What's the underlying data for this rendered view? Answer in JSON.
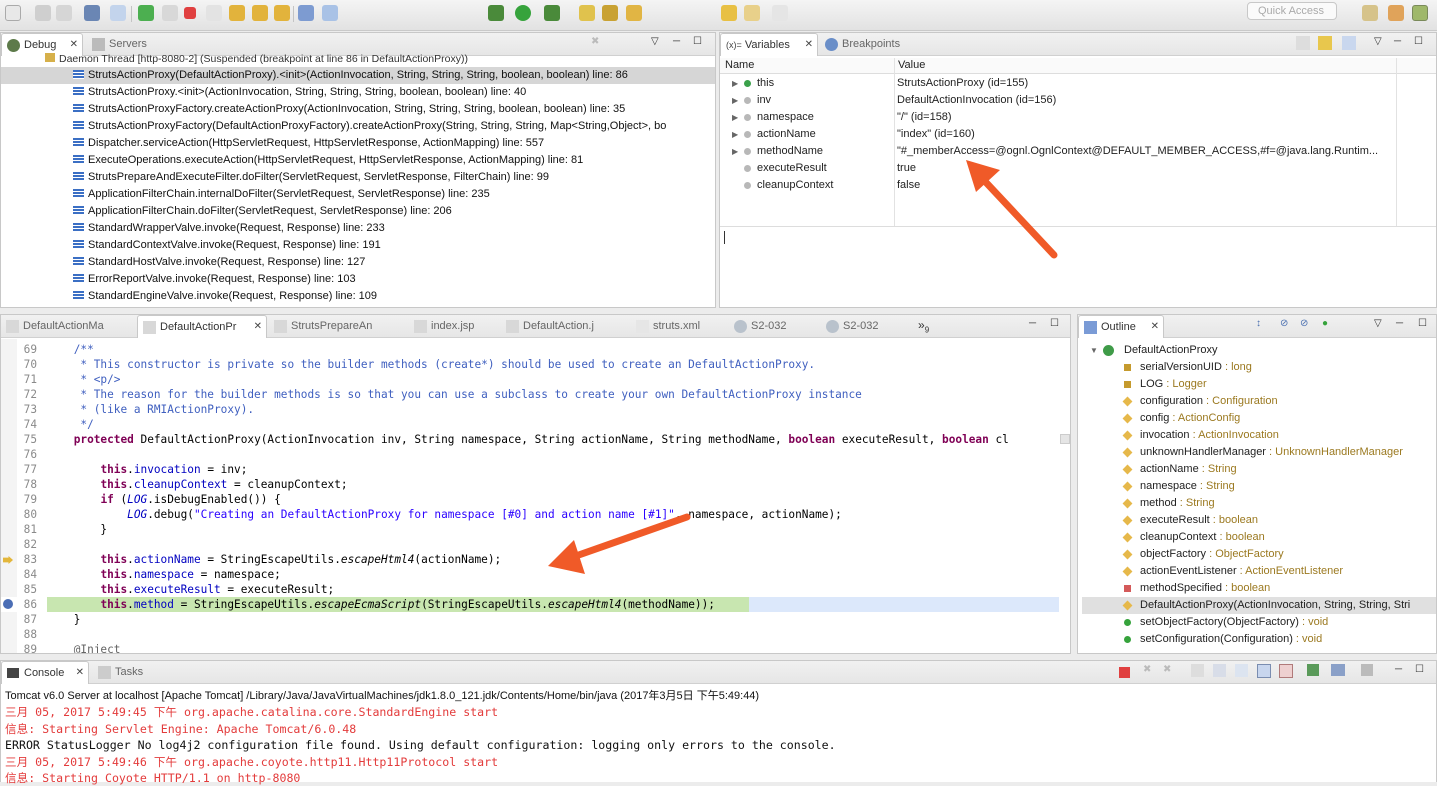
{
  "colors": {
    "accent_orange": "#f05a28",
    "highlight_green": "#c8e6b0",
    "exec_line": "#dce8fb",
    "console_red": "#e33b3b"
  },
  "toolbar": {
    "quick_access_placeholder": "Quick Access"
  },
  "debug_view": {
    "tabs": [
      {
        "label": "Debug",
        "icon": "debug-bug-icon"
      },
      {
        "label": "Servers",
        "icon": "servers-icon"
      }
    ],
    "thread_label": "Daemon Thread [http-8080-2] (Suspended (breakpoint at line 86 in DefaultActionProxy))",
    "frames": [
      "StrutsActionProxy(DefaultActionProxy).<init>(ActionInvocation, String, String, String, boolean, boolean) line: 86",
      "StrutsActionProxy.<init>(ActionInvocation, String, String, String, boolean, boolean) line: 40",
      "StrutsActionProxyFactory.createActionProxy(ActionInvocation, String, String, String, boolean, boolean) line: 35",
      "StrutsActionProxyFactory(DefaultActionProxyFactory).createActionProxy(String, String, String, Map<String,Object>, bo",
      "Dispatcher.serviceAction(HttpServletRequest, HttpServletResponse, ActionMapping) line: 557",
      "ExecuteOperations.executeAction(HttpServletRequest, HttpServletResponse, ActionMapping) line: 81",
      "StrutsPrepareAndExecuteFilter.doFilter(ServletRequest, ServletResponse, FilterChain) line: 99",
      "ApplicationFilterChain.internalDoFilter(ServletRequest, ServletResponse) line: 235",
      "ApplicationFilterChain.doFilter(ServletRequest, ServletResponse) line: 206",
      "StandardWrapperValve.invoke(Request, Response) line: 233",
      "StandardContextValve.invoke(Request, Response) line: 191",
      "StandardHostValve.invoke(Request, Response) line: 127",
      "ErrorReportValve.invoke(Request, Response) line: 103",
      "StandardEngineValve.invoke(Request, Response) line: 109"
    ]
  },
  "variables_view": {
    "tabs": [
      {
        "label": "Variables",
        "prefix": "(x)="
      },
      {
        "label": "Breakpoints"
      }
    ],
    "col_name": "Name",
    "col_value": "Value",
    "rows": [
      {
        "name": "this",
        "value": "StrutsActionProxy  (id=155)",
        "expandable": true,
        "icon": "green"
      },
      {
        "name": "inv",
        "value": "DefaultActionInvocation  (id=156)",
        "expandable": true,
        "icon": "grey"
      },
      {
        "name": "namespace",
        "value": "\"/\" (id=158)",
        "expandable": true,
        "icon": "grey"
      },
      {
        "name": "actionName",
        "value": "\"index\" (id=160)",
        "expandable": true,
        "icon": "grey"
      },
      {
        "name": "methodName",
        "value": "\"#_memberAccess=@ognl.OgnlContext@DEFAULT_MEMBER_ACCESS,#f=@java.lang.Runtim...",
        "expandable": true,
        "icon": "grey"
      },
      {
        "name": "executeResult",
        "value": "true",
        "expandable": false,
        "icon": "grey"
      },
      {
        "name": "cleanupContext",
        "value": "false",
        "expandable": false,
        "icon": "grey"
      }
    ]
  },
  "editor": {
    "tabs": [
      {
        "label": "DefaultActionMa",
        "active": false
      },
      {
        "label": "DefaultActionPr",
        "active": true
      },
      {
        "label": "StrutsPrepareAn",
        "active": false
      },
      {
        "label": "index.jsp",
        "active": false
      },
      {
        "label": "DefaultAction.j",
        "active": false
      },
      {
        "label": "struts.xml",
        "active": false
      },
      {
        "label": "S2-032",
        "active": false
      },
      {
        "label": "S2-032",
        "active": false
      }
    ],
    "overflow_label": "»",
    "overflow_count": "9",
    "line_numbers": [
      "69",
      "70",
      "71",
      "72",
      "73",
      "74",
      "75",
      "76",
      "77",
      "78",
      "79",
      "80",
      "81",
      "82",
      "83",
      "84",
      "85",
      "86",
      "87",
      "88",
      "89"
    ],
    "lines": [
      "    /**",
      "     * This constructor is private so the builder methods (create*) should be used to create an DefaultActionProxy.",
      "     * <p/>",
      "     * The reason for the builder methods is so that you can use a subclass to create your own DefaultActionProxy instance",
      "     * (like a RMIActionProxy).",
      "     */",
      "    protected DefaultActionProxy(ActionInvocation inv, String namespace, String actionName, String methodName, boolean executeResult, boolean cl",
      "",
      "        this.invocation = inv;",
      "        this.cleanupContext = cleanupContext;",
      "        if (LOG.isDebugEnabled()) {",
      "            LOG.debug(\"Creating an DefaultActionProxy for namespace [#0] and action name [#1]\", namespace, actionName);",
      "        }",
      "",
      "        this.actionName = StringEscapeUtils.escapeHtml4(actionName);",
      "        this.namespace = namespace;",
      "        this.executeResult = executeResult;",
      "        this.method = StringEscapeUtils.escapeEcmaScript(StringEscapeUtils.escapeHtml4(methodName));",
      "    }",
      "",
      "    @Inject"
    ]
  },
  "outline_view": {
    "tab": "Outline",
    "root": "DefaultActionProxy",
    "items": [
      {
        "name": "serialVersionUID",
        "type": " : long",
        "icon": "static-final"
      },
      {
        "name": "LOG",
        "type": " : Logger",
        "icon": "static-final"
      },
      {
        "name": "configuration",
        "type": " : Configuration",
        "icon": "protected"
      },
      {
        "name": "config",
        "type": " : ActionConfig",
        "icon": "protected"
      },
      {
        "name": "invocation",
        "type": " : ActionInvocation",
        "icon": "protected"
      },
      {
        "name": "unknownHandlerManager",
        "type": " : UnknownHandlerManager",
        "icon": "protected"
      },
      {
        "name": "actionName",
        "type": " : String",
        "icon": "protected"
      },
      {
        "name": "namespace",
        "type": " : String",
        "icon": "protected"
      },
      {
        "name": "method",
        "type": " : String",
        "icon": "protected"
      },
      {
        "name": "executeResult",
        "type": " : boolean",
        "icon": "protected"
      },
      {
        "name": "cleanupContext",
        "type": " : boolean",
        "icon": "protected"
      },
      {
        "name": "objectFactory",
        "type": " : ObjectFactory",
        "icon": "protected"
      },
      {
        "name": "actionEventListener",
        "type": " : ActionEventListener",
        "icon": "protected"
      },
      {
        "name": "methodSpecified",
        "type": " : boolean",
        "icon": "private"
      },
      {
        "name": "DefaultActionProxy(ActionInvocation, String, String, Stri",
        "type": "",
        "icon": "constructor"
      },
      {
        "name": "setObjectFactory(ObjectFactory)",
        "type": " : void",
        "icon": "public"
      },
      {
        "name": "setConfiguration(Configuration)",
        "type": " : void",
        "icon": "public"
      }
    ]
  },
  "console_view": {
    "tabs": [
      {
        "label": "Console"
      },
      {
        "label": "Tasks"
      }
    ],
    "header": "Tomcat v6.0 Server at localhost [Apache Tomcat] /Library/Java/JavaVirtualMachines/jdk1.8.0_121.jdk/Contents/Home/bin/java (2017年3月5日 下午5:49:44)",
    "lines": [
      {
        "text": "三月 05, 2017 5:49:45 下午 org.apache.catalina.core.StandardEngine start",
        "color": "red"
      },
      {
        "text": "信息: Starting Servlet Engine: Apache Tomcat/6.0.48",
        "color": "red"
      },
      {
        "text": "ERROR StatusLogger No log4j2 configuration file found. Using default configuration: logging only errors to the console.",
        "color": "black"
      },
      {
        "text": "三月 05, 2017 5:49:46 下午 org.apache.coyote.http11.Http11Protocol start",
        "color": "red"
      },
      {
        "text": "信息: Starting Coyote HTTP/1.1 on http-8080",
        "color": "red"
      }
    ]
  }
}
